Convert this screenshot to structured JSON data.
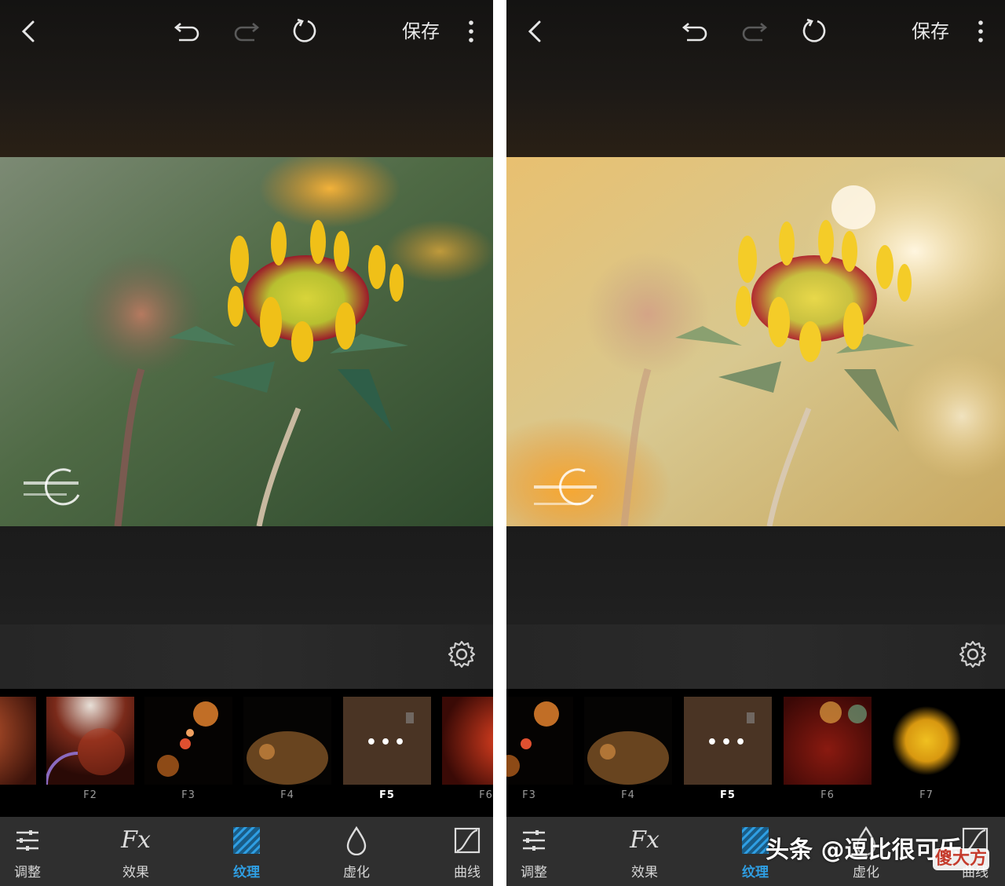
{
  "left_panel": {
    "save_label": "保存",
    "thumbs": [
      {
        "label": ""
      },
      {
        "label": "F2"
      },
      {
        "label": "F3"
      },
      {
        "label": "F4"
      },
      {
        "label": "F5",
        "selected": true
      },
      {
        "label": "F6"
      }
    ]
  },
  "right_panel": {
    "save_label": "保存",
    "thumbs": [
      {
        "label": "F3"
      },
      {
        "label": "F4"
      },
      {
        "label": "F5",
        "selected": true
      },
      {
        "label": "F6"
      },
      {
        "label": "F7"
      }
    ]
  },
  "more_indicator": "•••",
  "tabs": [
    {
      "id": "adjust",
      "label": "调整",
      "icon": "sliders-icon"
    },
    {
      "id": "effects",
      "label": "效果",
      "icon": "fx-icon",
      "glyph": "Fx"
    },
    {
      "id": "texture",
      "label": "纹理",
      "icon": "texture-stripes-icon",
      "active": true
    },
    {
      "id": "blur",
      "label": "虚化",
      "icon": "droplet-icon"
    },
    {
      "id": "curves",
      "label": "曲线",
      "icon": "curve-icon"
    }
  ],
  "watermark": {
    "text": "头条 @逗比很可乐",
    "badge": "傻大方"
  },
  "colors": {
    "active_tab": "#2f9fe4",
    "tab_text": "#d6d6d6",
    "tab_bar_bg": "#2f2f2f",
    "strip_bg": "#000000"
  }
}
